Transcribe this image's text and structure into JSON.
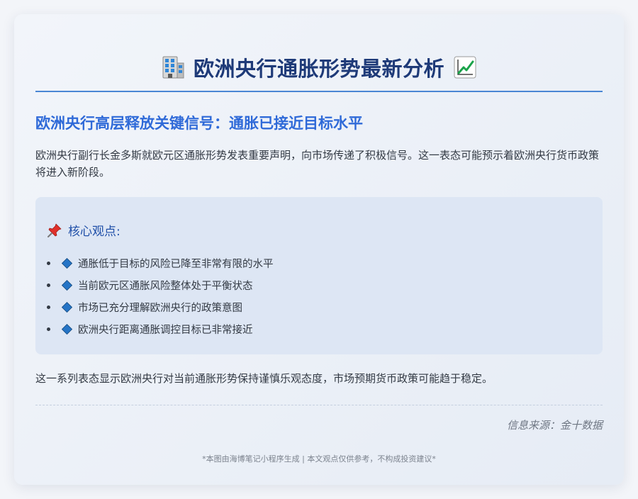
{
  "header": {
    "title": "欧洲央行通胀形势最新分析",
    "left_icon": "office-building-icon",
    "right_icon": "chart-increasing-icon"
  },
  "article": {
    "subtitle": "欧洲央行高层释放关键信号：通胀已接近目标水平",
    "intro": "欧洲央行副行长金多斯就欧元区通胀形势发表重要声明，向市场传递了积极信号。这一表态可能预示着欧洲央行货币政策将进入新阶段。",
    "key_points": {
      "icon": "pushpin-icon",
      "title": "核心观点:",
      "items": [
        "通胀低于目标的风险已降至非常有限的水平",
        "当前欧元区通胀风险整体处于平衡状态",
        "市场已充分理解欧洲央行的政策意图",
        "欧洲央行距离通胀调控目标已非常接近"
      ]
    },
    "summary": "这一系列表态显示欧洲央行对当前通胀形势保持谨慎乐观态度，市场预期货币政策可能趋于稳定。",
    "source": "信息来源：金十数据"
  },
  "footer": {
    "note": "*本图由海博笔记小程序生成 | 本文观点仅供参考，不构成投资建议*"
  },
  "colors": {
    "title": "#1e3a78",
    "subtitle": "#2f6ad8",
    "accent_rule": "#4a86d4",
    "panel_bg": "#dde6f4",
    "body_text": "#333a44"
  }
}
